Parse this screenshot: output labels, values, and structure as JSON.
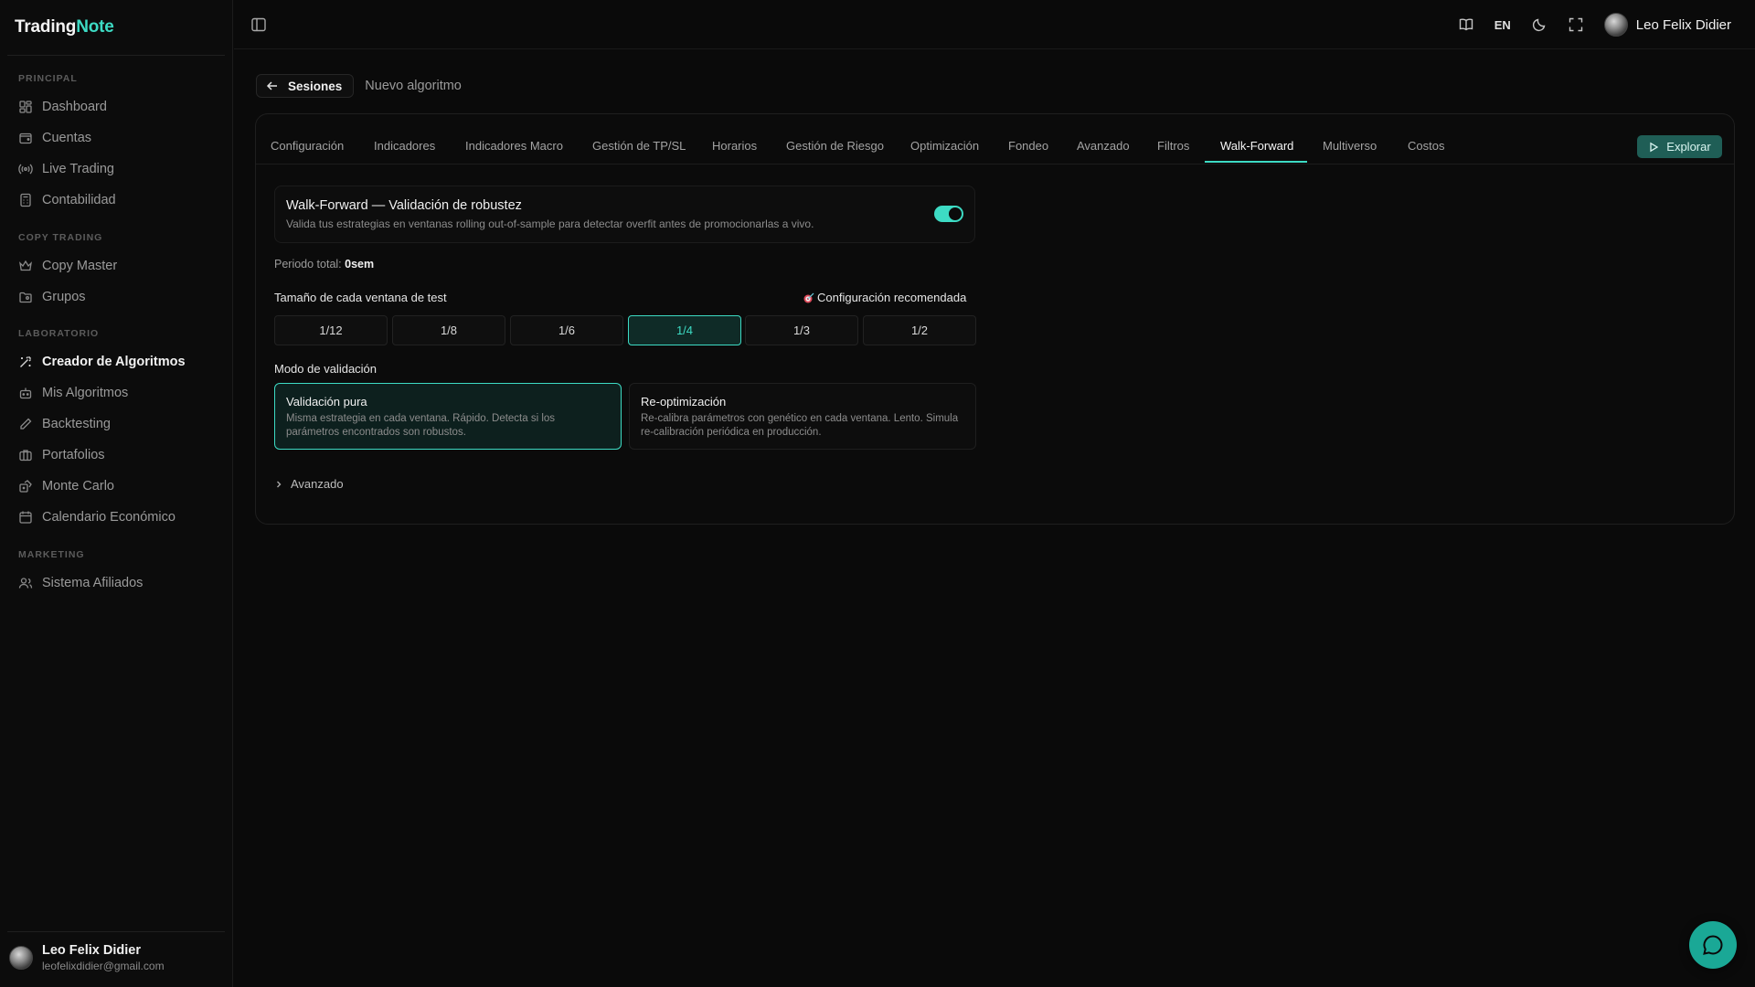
{
  "app": {
    "logo_main": "Trading",
    "logo_accent": "Note"
  },
  "colors": {
    "accent": "#3ddbc4",
    "background": "#0a0a0a",
    "explore_button": "#1f5e56",
    "chat_fab": "#1aa896"
  },
  "sidebar": {
    "sections": [
      {
        "label": "PRINCIPAL",
        "items": [
          {
            "label": "Dashboard",
            "icon": "grid-icon"
          },
          {
            "label": "Cuentas",
            "icon": "wallet-icon"
          },
          {
            "label": "Live Trading",
            "icon": "broadcast-icon"
          },
          {
            "label": "Contabilidad",
            "icon": "calculator-icon"
          }
        ]
      },
      {
        "label": "COPY TRADING",
        "items": [
          {
            "label": "Copy Master",
            "icon": "crown-icon"
          },
          {
            "label": "Grupos",
            "icon": "folder-users-icon"
          }
        ]
      },
      {
        "label": "LABORATORIO",
        "items": [
          {
            "label": "Creador de Algoritmos",
            "icon": "wand-icon",
            "active": true
          },
          {
            "label": "Mis Algoritmos",
            "icon": "bot-icon"
          },
          {
            "label": "Backtesting",
            "icon": "pencil-icon"
          },
          {
            "label": "Portafolios",
            "icon": "briefcase-icon"
          },
          {
            "label": "Monte Carlo",
            "icon": "dice-icon"
          },
          {
            "label": "Calendario Económico",
            "icon": "calendar-icon"
          }
        ]
      },
      {
        "label": "MARKETING",
        "items": [
          {
            "label": "Sistema Afiliados",
            "icon": "users-icon"
          }
        ]
      }
    ],
    "user": {
      "name": "Leo Felix Didier",
      "email": "leofelixdidier@gmail.com"
    }
  },
  "topbar": {
    "lang": "EN",
    "user_name": "Leo Felix Didier"
  },
  "breadcrumb": {
    "back_label": "Sesiones",
    "current": "Nuevo algoritmo"
  },
  "tabs": [
    {
      "label": "Configuración"
    },
    {
      "label": "Indicadores"
    },
    {
      "label": "Indicadores Macro"
    },
    {
      "label": "Gestión de TP/SL"
    },
    {
      "label": "Horarios"
    },
    {
      "label": "Gestión de Riesgo"
    },
    {
      "label": "Optimización"
    },
    {
      "label": "Fondeo"
    },
    {
      "label": "Avanzado"
    },
    {
      "label": "Filtros"
    },
    {
      "label": "Walk-Forward",
      "active": true
    },
    {
      "label": "Multiverso"
    },
    {
      "label": "Costos"
    }
  ],
  "explore_label": "Explorar",
  "walkforward": {
    "title": "Walk-Forward — Validación de robustez",
    "description": "Valida tus estrategias en ventanas rolling out-of-sample para detectar overfit antes de promocionarlas a vivo.",
    "enabled": true,
    "period_label": "Periodo total:",
    "period_value": "0sem",
    "window_label": "Tamaño de cada ventana de test",
    "recommended_label": "Configuración recomendada",
    "window_options": [
      "1/12",
      "1/8",
      "1/6",
      "1/4",
      "1/3",
      "1/2"
    ],
    "window_selected": "1/4",
    "mode_label": "Modo de validación",
    "modes": [
      {
        "title": "Validación pura",
        "desc": "Misma estrategia en cada ventana. Rápido. Detecta si los parámetros encontrados son robustos.",
        "selected": true
      },
      {
        "title": "Re-optimización",
        "desc": "Re-calibra parámetros con genético en cada ventana. Lento. Simula re-calibración periódica en producción.",
        "selected": false
      }
    ],
    "advanced_label": "Avanzado"
  }
}
